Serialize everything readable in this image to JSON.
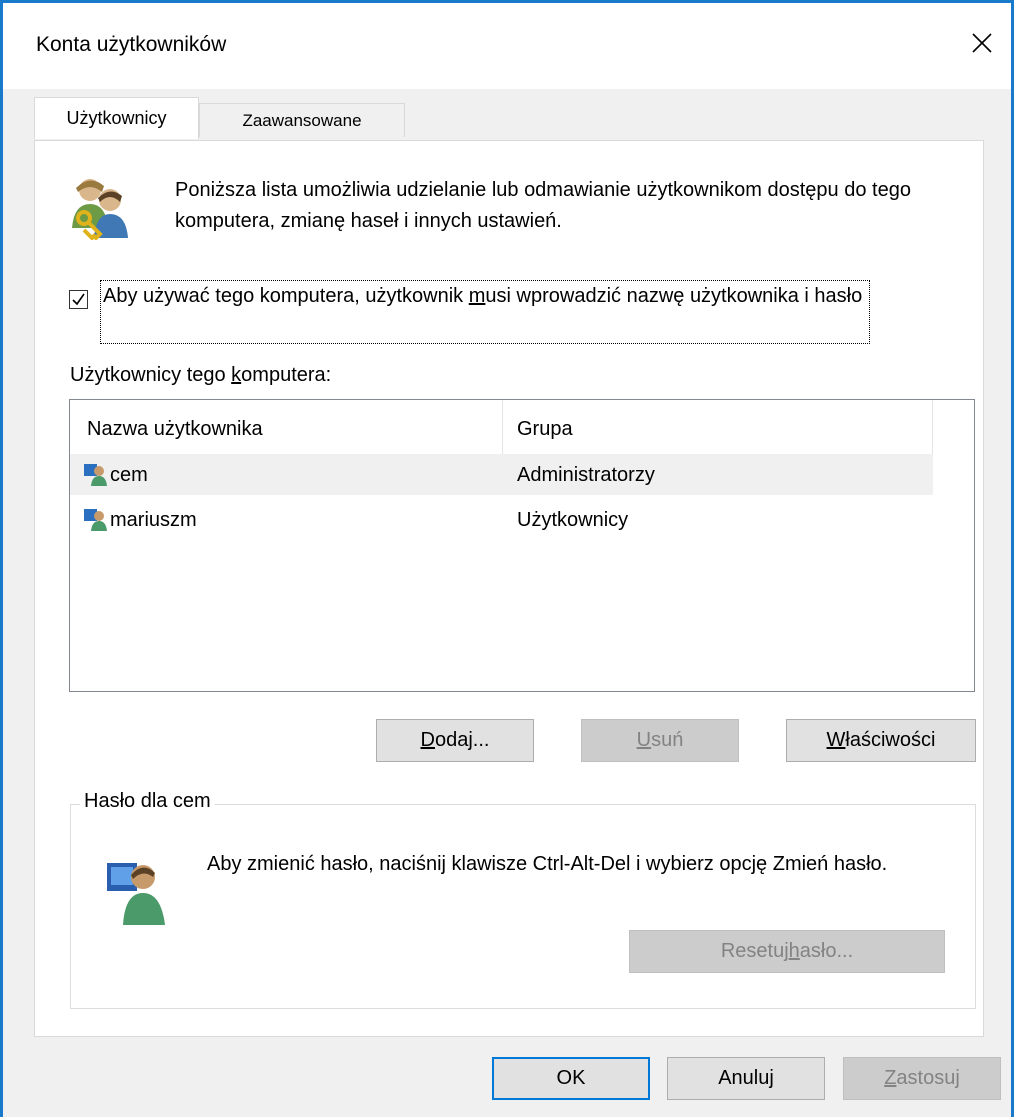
{
  "window": {
    "title": "Konta użytkowników",
    "close_glyph": "✕"
  },
  "tabs": [
    {
      "label": "Użytkownicy",
      "active": true
    },
    {
      "label": "Zaawansowane",
      "active": false
    }
  ],
  "intro": {
    "text": "Poniższa lista umożliwia udzielanie lub odmawianie użytkownikom dostępu do tego komputera, zmianę haseł i innych ustawień.",
    "icon": "users-key-icon"
  },
  "require_login": {
    "checked": true,
    "label_pre": "Aby używać tego komputera, użytkownik ",
    "label_accel": "m",
    "label_post": "usi wprowadzić nazwę użytkownika i hasło"
  },
  "users_caption": {
    "pre": "Użytkownicy tego ",
    "accel": "k",
    "post": "omputera:"
  },
  "user_list": {
    "columns": [
      "Nazwa użytkownika",
      "Grupa"
    ],
    "rows": [
      {
        "name": "cem",
        "group": "Administratorzy",
        "selected": true
      },
      {
        "name": "mariuszm",
        "group": "Użytkownicy",
        "selected": false
      }
    ]
  },
  "list_buttons": {
    "add": {
      "accel": "D",
      "rest": "odaj...",
      "disabled": false
    },
    "remove": {
      "accel": "U",
      "rest": "suń",
      "disabled": true
    },
    "properties": {
      "accel": "W",
      "rest": "łaściwości",
      "disabled": false
    }
  },
  "password_group": {
    "title": "Hasło dla cem",
    "text": "Aby zmienić hasło, naciśnij klawisze Ctrl-Alt-Del i wybierz opcję Zmień hasło.",
    "reset_pre": "Resetuj ",
    "reset_accel": "h",
    "reset_post": "asło...",
    "reset_disabled": true
  },
  "footer_buttons": {
    "ok": "OK",
    "cancel": "Anuluj",
    "apply_accel": "Z",
    "apply_rest": "astosuj",
    "apply_disabled": true
  },
  "colors": {
    "accent": "#1979ca",
    "default_button_border": "#0078d7",
    "selected_row": "#f0f0f0"
  }
}
